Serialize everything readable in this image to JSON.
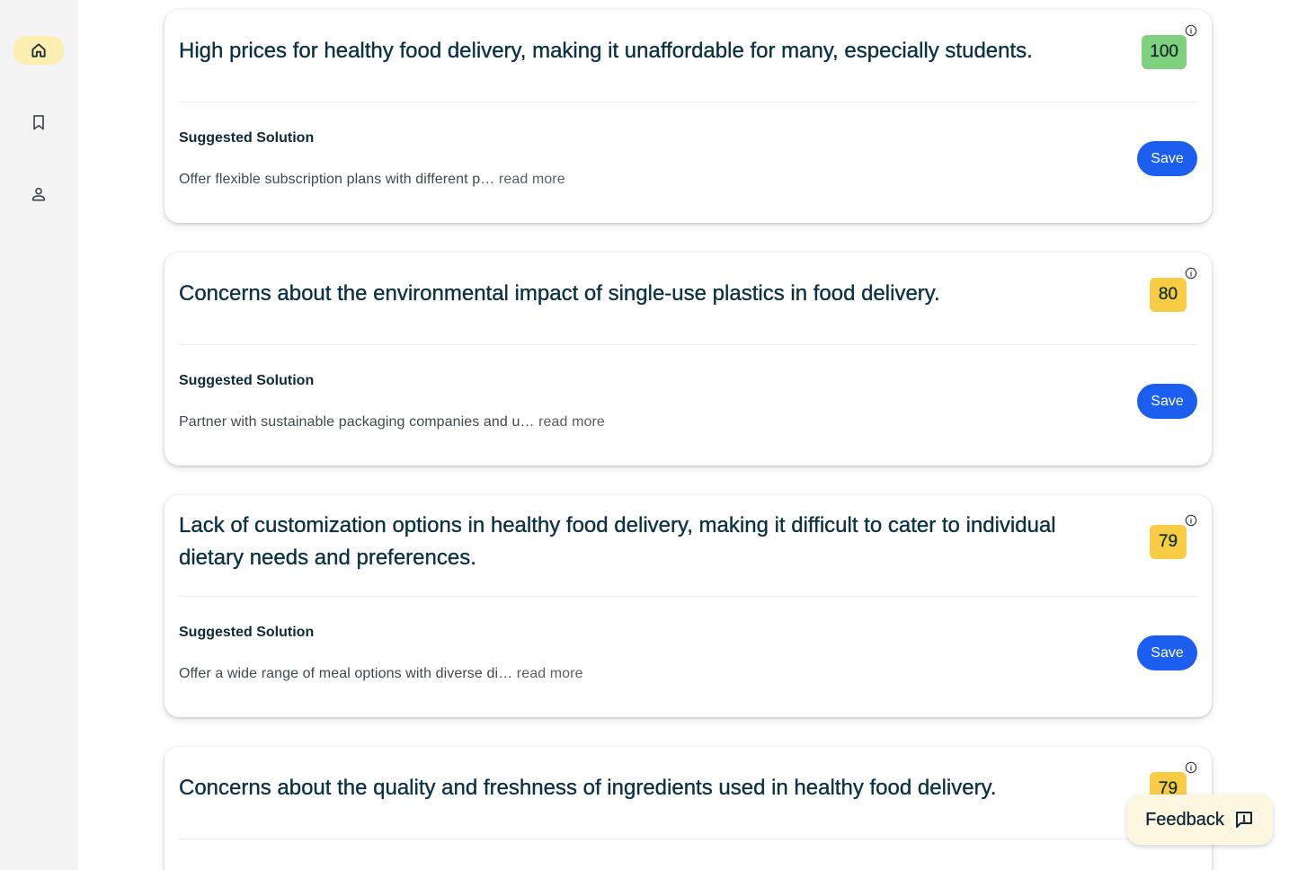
{
  "sidebar": {
    "items": [
      {
        "icon": "home-icon",
        "active": true
      },
      {
        "icon": "bookmark-icon",
        "active": false
      },
      {
        "icon": "person-icon",
        "active": false
      }
    ]
  },
  "cards": [
    {
      "problem": "High prices for healthy food delivery, making it unaffordable for many, especially students.",
      "score": "100",
      "score_color": "#7fd07f",
      "solution_label": "Suggested Solution",
      "solution_excerpt": "Offer flexible subscription plans with different p…",
      "read_more": "read more",
      "save_label": "Save"
    },
    {
      "problem": "Concerns about the environmental impact of single-use plastics in food delivery.",
      "score": "80",
      "score_color": "#f8cd45",
      "solution_label": "Suggested Solution",
      "solution_excerpt": "Partner with sustainable packaging companies and u…",
      "read_more": "read more",
      "save_label": "Save"
    },
    {
      "problem": "Lack of customization options in healthy food delivery, making it difficult to cater to individual dietary needs and preferences.",
      "score": "79",
      "score_color": "#f8cd45",
      "solution_label": "Suggested Solution",
      "solution_excerpt": "Offer a wide range of meal options with diverse di…",
      "read_more": "read more",
      "save_label": "Save"
    },
    {
      "problem": "Concerns about the quality and freshness of ingredients used in healthy food delivery.",
      "score": "79",
      "score_color": "#f8cd45"
    }
  ],
  "feedback": {
    "label": "Feedback",
    "icon": "feedback-icon"
  },
  "colors": {
    "accent": "#1b5ef0",
    "active_nav": "#fdefb2",
    "sidebar_bg": "#f3f3f3",
    "feedback_bg": "#fdf7e2"
  }
}
